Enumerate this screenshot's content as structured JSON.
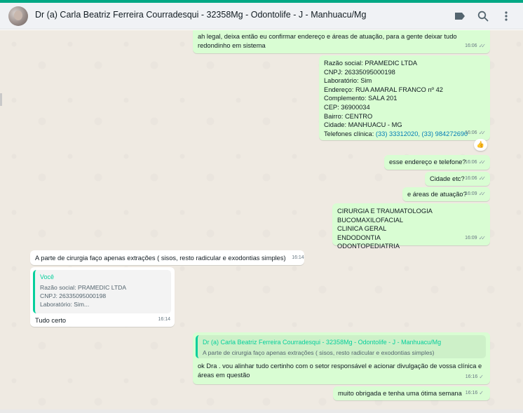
{
  "header": {
    "contact_name": "Dr (a) Carla Beatriz Ferreira Courradesqui - 32358Mg - Odontolife - J - Manhuacu/Mg",
    "icons": [
      "label-icon",
      "search-icon",
      "menu-icon"
    ]
  },
  "colors": {
    "accent": "#00a884",
    "outgoing_bubble": "#d9fdd3",
    "incoming_bubble": "#ffffff",
    "chat_background": "#efeae2",
    "link": "#027eb5",
    "quote_accent": "#06cf9c"
  },
  "messages": {
    "m1": {
      "lines": [
        "ah legal, deixa então eu confirmar endereço e áreas de atuação, para a gente deixar tudo",
        "redondinho em sistema"
      ],
      "time": "16:06"
    },
    "m2": {
      "lines": [
        "Razão social: PRAMEDIC LTDA",
        "CNPJ: 26335095000198",
        "Laboratório: Sim",
        "Endereço: RUA AMARAL FRANCO nº 42",
        "Complemento: SALA 201",
        "CEP: 36900034",
        "Bairro: CENTRO",
        "Cidade: MANHUACU - MG"
      ],
      "phones_label": "Telefones clínica: ",
      "phones": "(33) 33312020, (33) 984272690",
      "time": "16:06",
      "reaction": "👍"
    },
    "m3": {
      "text": "esse endereço e telefone?",
      "time": "16:06"
    },
    "m4": {
      "text": "Cidade etc?",
      "time": "16:06"
    },
    "m5": {
      "text": "e áreas de atuação?",
      "time": "16:09"
    },
    "m6": {
      "lines": [
        "CIRURGIA E TRAUMATOLOGIA BUCOMAXILOFACIAL",
        "CLINICA GERAL",
        "ENDODONTIA",
        "ODONTOPEDIATRIA"
      ],
      "time": "16:09"
    },
    "m7": {
      "text": "A parte de cirurgia faço apenas extrações ( sisos, resto radicular e exodontias simples)",
      "time": "16:14"
    },
    "m8": {
      "quote_author": "Você",
      "quote_lines": [
        "Razão social: PRAMEDIC LTDA",
        "CNPJ: 26335095000198",
        "Laboratório: Sim..."
      ],
      "text": "Tudo certo",
      "time": "16:14"
    },
    "m9": {
      "quote_author": "Dr (a) Carla Beatriz Ferreira Courradesqui - 32358Mg - Odontolife - J - Manhuacu/Mg",
      "quote_text": "A parte de cirurgia faço apenas extrações ( sisos, resto radicular e exodontias simples)",
      "lines": [
        "ok Dra . vou alinhar tudo certinho com o setor responsável e acionar divulgação de vossa clínica e",
        "áreas em questão"
      ],
      "time": "16:16"
    },
    "m10": {
      "text": "muito obrigada e tenha uma ótima semana",
      "time": "16:16"
    }
  }
}
